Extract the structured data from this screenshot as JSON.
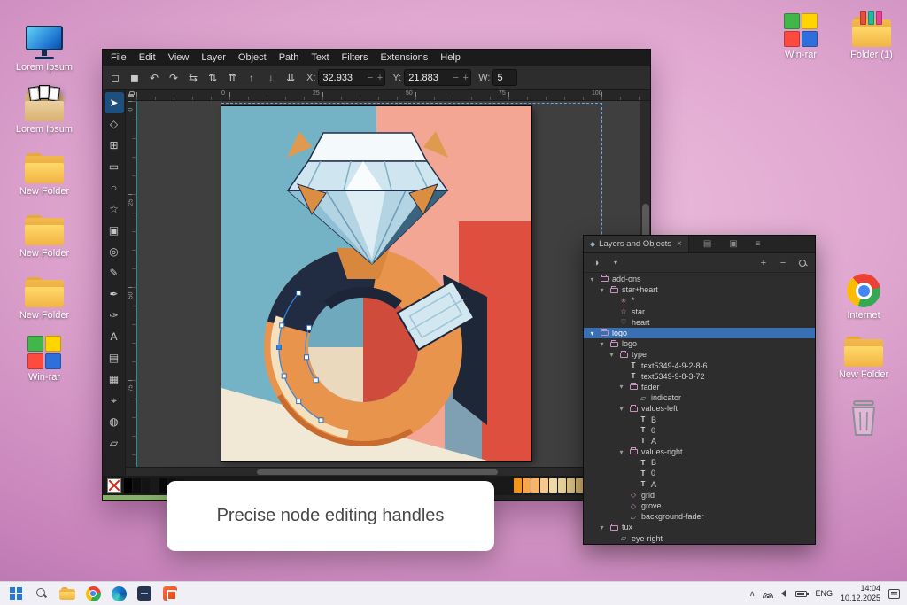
{
  "desktop": {
    "left_icons": [
      {
        "label": "Lorem Ipsum",
        "icon": "monitor-icon"
      },
      {
        "label": "Lorem Ipsum",
        "icon": "documents-folder-icon"
      },
      {
        "label": "New Folder",
        "icon": "folder-icon"
      },
      {
        "label": "New Folder",
        "icon": "folder-icon"
      },
      {
        "label": "New Folder",
        "icon": "folder-icon"
      },
      {
        "label": "Win-rar",
        "icon": "winrar-icon"
      }
    ],
    "top_right_icons": [
      {
        "label": "Win-rar",
        "icon": "winrar-icon"
      },
      {
        "label": "Folder (1)",
        "icon": "books-folder-icon"
      }
    ],
    "mid_right_icons": [
      {
        "label": "Internet",
        "icon": "chrome-icon"
      },
      {
        "label": "New Folder",
        "icon": "folder-icon"
      },
      {
        "label": "",
        "icon": "trash-icon"
      }
    ]
  },
  "window": {
    "menu_items": [
      "File",
      "Edit",
      "View",
      "Layer",
      "Object",
      "Path",
      "Text",
      "Filters",
      "Extensions",
      "Help"
    ],
    "toolbar_icons": [
      "select-all-icon",
      "deselect-icon",
      "rotate-ccw-icon",
      "rotate-cw-icon",
      "flip-horizontal-icon",
      "flip-vertical-icon",
      "raise-top-icon",
      "raise-icon",
      "lower-icon",
      "lower-bottom-icon"
    ],
    "fields": {
      "x_label": "X:",
      "x_value": "32.933",
      "y_label": "Y:",
      "y_value": "21.883",
      "w_label": "W:",
      "w_value": "5",
      "minus": "−",
      "plus": "+"
    },
    "tools": [
      "selector-tool",
      "node-tool",
      "shape-builder-tool",
      "rectangle-tool",
      "ellipse-tool",
      "star-tool",
      "box3d-tool",
      "spiral-tool",
      "pencil-tool",
      "pen-tool",
      "calligraphy-tool",
      "text-tool",
      "gradient-tool",
      "mesh-tool",
      "dropper-tool",
      "bucket-tool",
      "eraser-tool"
    ],
    "ruler_top_numbers": [
      "0",
      "25",
      "50",
      "75",
      "100"
    ],
    "ruler_left_numbers": [
      "0",
      "25",
      "50",
      "75"
    ],
    "palette_dark": [
      "#000000",
      "#0d0d0d",
      "#141414",
      "#1a1a1a",
      "#0a0a0a",
      "#111111",
      "#161616"
    ],
    "palette_warm": [
      "#f7941d",
      "#f9a64a",
      "#f8b56a",
      "#f3c98c",
      "#eed8a8",
      "#e8d29b",
      "#dfc384",
      "#d5b46c",
      "#cca554",
      "#f2e3c2",
      "#ead8ad",
      "#e0ca92",
      "#d6bb78",
      "#ccad60",
      "#c29e49"
    ]
  },
  "layers_panel": {
    "title": "Layers and Objects",
    "tree": [
      {
        "label": "add-ons",
        "depth": 0,
        "icon": "folder",
        "expanded": true
      },
      {
        "label": "star+heart",
        "depth": 1,
        "icon": "folder",
        "expanded": true
      },
      {
        "label": "*",
        "depth": 2,
        "icon": "asterisk"
      },
      {
        "label": "star",
        "depth": 2,
        "icon": "star"
      },
      {
        "label": "heart",
        "depth": 2,
        "icon": "heart"
      },
      {
        "label": "logo",
        "depth": 0,
        "icon": "folder",
        "expanded": true,
        "selected": true
      },
      {
        "label": "logo",
        "depth": 1,
        "icon": "folder",
        "expanded": true
      },
      {
        "label": "type",
        "depth": 2,
        "icon": "folder",
        "expanded": true
      },
      {
        "label": "text5349-4-9-2-8-6",
        "depth": 3,
        "icon": "text"
      },
      {
        "label": "text5349-9-8-3-72",
        "depth": 3,
        "icon": "text"
      },
      {
        "label": "fader",
        "depth": 3,
        "icon": "folder",
        "expanded": true
      },
      {
        "label": "indicator",
        "depth": 4,
        "icon": "shape"
      },
      {
        "label": "values-left",
        "depth": 3,
        "icon": "folder",
        "expanded": true
      },
      {
        "label": "B",
        "depth": 4,
        "icon": "text"
      },
      {
        "label": "0",
        "depth": 4,
        "icon": "text"
      },
      {
        "label": "A",
        "depth": 4,
        "icon": "text"
      },
      {
        "label": "values-right",
        "depth": 3,
        "icon": "folder",
        "expanded": true
      },
      {
        "label": "B",
        "depth": 4,
        "icon": "text"
      },
      {
        "label": "0",
        "depth": 4,
        "icon": "text"
      },
      {
        "label": "A",
        "depth": 4,
        "icon": "text"
      },
      {
        "label": "grid",
        "depth": 3,
        "icon": "path"
      },
      {
        "label": "grove",
        "depth": 3,
        "icon": "path"
      },
      {
        "label": "background-fader",
        "depth": 3,
        "icon": "shape"
      },
      {
        "label": "tux",
        "depth": 1,
        "icon": "folder",
        "expanded": true
      },
      {
        "label": "eye-right",
        "depth": 2,
        "icon": "shape"
      }
    ]
  },
  "tooltip": {
    "text": "Precise node editing handles"
  },
  "taskbar": {
    "icons": [
      "start-icon",
      "search-icon",
      "explorer-icon",
      "chrome-icon",
      "edge-icon",
      "code-app-icon",
      "presentation-app-icon"
    ],
    "language": "ENG",
    "time": "14:04",
    "date": "10.12.2025"
  }
}
